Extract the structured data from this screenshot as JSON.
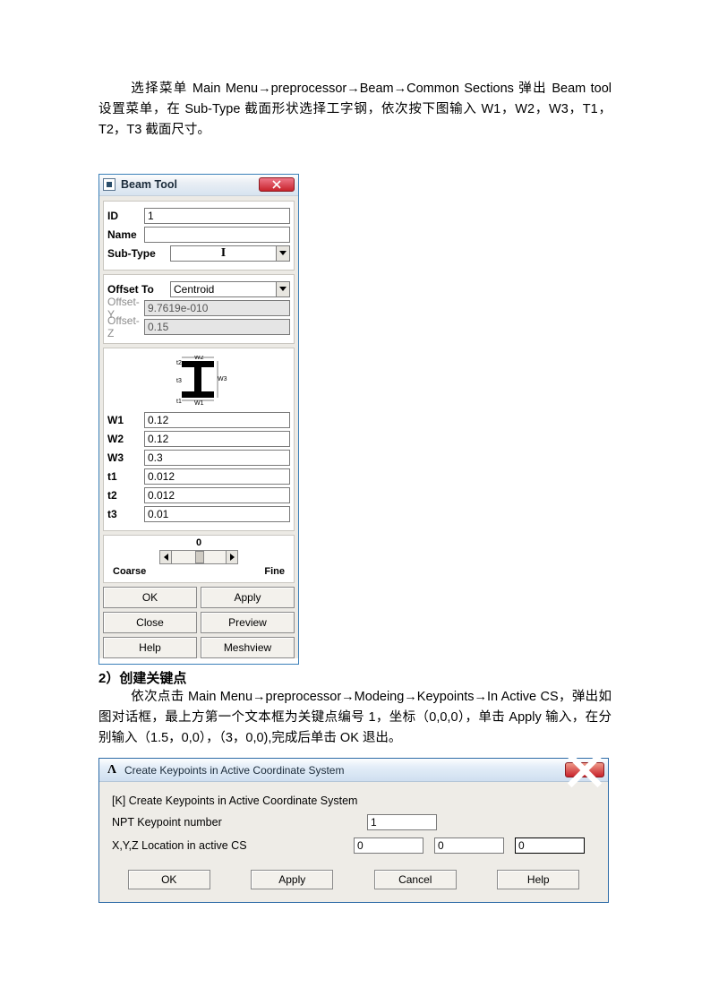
{
  "paragraph1": "选择菜单 Main Menu→preprocessor→Beam→Common Sections 弹出 Beam tool 设置菜单，在 Sub-Type 截面形状选择工字钢，依次按下图输入 W1，W2，W3，T1，T2，T3 截面尺寸。",
  "beam_tool": {
    "title": "Beam Tool",
    "id_label": "ID",
    "id_value": "1",
    "name_label": "Name",
    "name_value": "",
    "subtype_label": "Sub-Type",
    "subtype_glyph": "I",
    "offset_to_label": "Offset To",
    "offset_to_value": "Centroid",
    "offset_y_label": "Offset-Y",
    "offset_y_value": "9.7619e-010",
    "offset_z_label": "Offset-Z",
    "offset_z_value": "0.15",
    "w1_label": "W1",
    "w1_value": "0.12",
    "w2_label": "W2",
    "w2_value": "0.12",
    "w3_label": "W3",
    "w3_value": "0.3",
    "t1_label": "t1",
    "t1_value": "0.012",
    "t2_label": "t2",
    "t2_value": "0.012",
    "t3_label": "t3",
    "t3_value": "0.01",
    "slider_value": "0",
    "coarse": "Coarse",
    "fine": "Fine",
    "ok": "OK",
    "apply": "Apply",
    "close": "Close",
    "preview": "Preview",
    "help": "Help",
    "meshview": "Meshview"
  },
  "section2_title": "2）创建关键点",
  "paragraph2": "依次点击 Main Menu→preprocessor→Modeing→Keypoints→In Active CS，弹出如图对话框，最上方第一个文本框为关键点编号 1，坐标（0,0,0），单击 Apply 输入，在分别输入（1.5，0,0），（3，0,0),完成后单击 OK 退出。",
  "kp_dialog": {
    "title": "Create Keypoints in Active Coordinate System",
    "heading": "[K]  Create Keypoints in Active Coordinate System",
    "npt_label": "NPT   Keypoint number",
    "npt_value": "1",
    "xyz_label": "X,Y,Z  Location in active CS",
    "x": "0",
    "y": "0",
    "z": "0",
    "ok": "OK",
    "apply": "Apply",
    "cancel": "Cancel",
    "help": "Help"
  }
}
